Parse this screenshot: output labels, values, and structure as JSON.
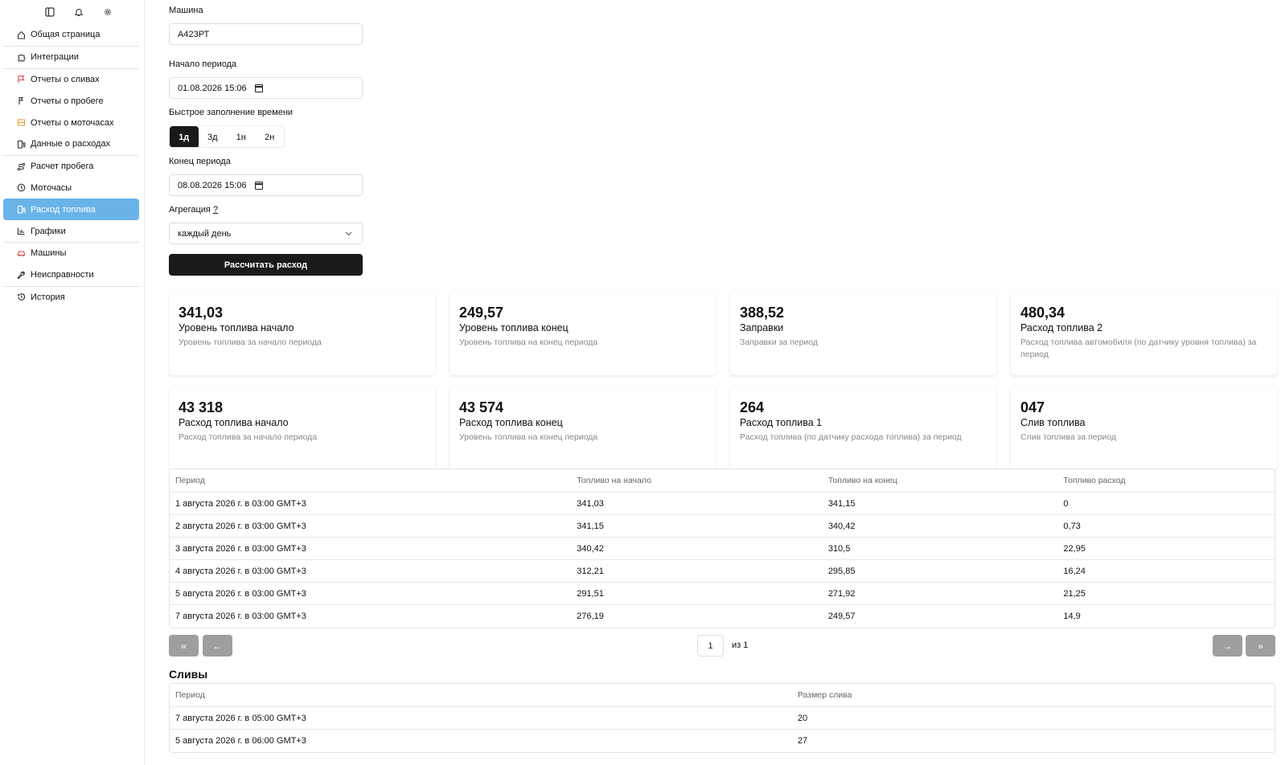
{
  "sidebar": {
    "top_icons": [
      "sidebar-toggle-icon",
      "bell-icon",
      "gear-icon"
    ],
    "items": [
      {
        "label": "Общая страница",
        "icon": "home-icon"
      },
      {
        "label": "Интеграции",
        "icon": "puzzle-icon"
      },
      {
        "label": "Отчеты о сливах",
        "icon": "flag-icon"
      },
      {
        "label": "Отчеты о пробеге",
        "icon": "route-flag-icon"
      },
      {
        "label": "Отчеты о моточасах",
        "icon": "engine-icon"
      },
      {
        "label": "Данные о расходах",
        "icon": "fuel-pump-icon"
      },
      {
        "label": "Расчет пробега",
        "icon": "route-icon"
      },
      {
        "label": "Моточасы",
        "icon": "clock-icon"
      },
      {
        "label": "Расход топлива",
        "icon": "fuel-icon"
      },
      {
        "label": "Графики",
        "icon": "chart-icon"
      },
      {
        "label": "Машины",
        "icon": "car-icon"
      },
      {
        "label": "Неисправности",
        "icon": "wrench-icon"
      },
      {
        "label": "История",
        "icon": "history-icon"
      }
    ],
    "active_index": 8,
    "accent_color": "#6ab3e8"
  },
  "form": {
    "machine_label": "Машина",
    "machine_value": "А423РТ",
    "start_label": "Начало периода",
    "start_value": "01.08.2026 15:06",
    "quick_label": "Быстрое заполнение времени",
    "quick_options": [
      "1д",
      "3д",
      "1н",
      "2н"
    ],
    "quick_selected": "1д",
    "end_label": "Конец периода",
    "end_value": "08.08.2026 15:06",
    "aggregation_label": "Агрегация",
    "aggregation_help": "?",
    "aggregation_value": "каждый день",
    "submit_label": "Рассчитать расход"
  },
  "cards": [
    {
      "value": "341,03",
      "title": "Уровень топлива начало",
      "subtitle": "Уровень топлива за начало периода"
    },
    {
      "value": "249,57",
      "title": "Уровень топлива конец",
      "subtitle": "Уровень топлива на конец периода"
    },
    {
      "value": "388,52",
      "title": "Заправки",
      "subtitle": "Заправки за период"
    },
    {
      "value": "480,34",
      "title": "Расход топлива 2",
      "subtitle": "Расход топлива автомобиля (по датчику уровня топлива) за период"
    },
    {
      "value": "43 318",
      "title": "Расход топлива начало",
      "subtitle": "Расход топлива за начало периода"
    },
    {
      "value": "43 574",
      "title": "Расход топлива конец",
      "subtitle": "Уровень топлива на конец периода"
    },
    {
      "value": "264",
      "title": "Расход топлива 1",
      "subtitle": "Расход топлива (по датчику расхода топлива) за период"
    },
    {
      "value": "047",
      "title": "Слив топлива",
      "subtitle": "Слив топлива за период"
    }
  ],
  "table": {
    "headers": [
      "Период",
      "Топливо на начало",
      "Топливо на конец",
      "Топливо расход"
    ],
    "rows": [
      [
        "1 августа 2026 г. в 03:00 GMT+3",
        "341,03",
        "341,15",
        "0"
      ],
      [
        "2 августа 2026 г. в 03:00 GMT+3",
        "341,15",
        "340,42",
        "0,73"
      ],
      [
        "3 августа 2026 г. в 03:00 GMT+3",
        "340,42",
        "310,5",
        "22,95"
      ],
      [
        "4 августа 2026 г. в 03:00 GMT+3",
        "312,21",
        "295,85",
        "16,24"
      ],
      [
        "5 августа 2026 г. в 03:00 GMT+3",
        "291,51",
        "271,92",
        "21,25"
      ],
      [
        "7 августа 2026 г. в 03:00 GMT+3",
        "276,19",
        "249,57",
        "14,9"
      ]
    ]
  },
  "pagination": {
    "first": "«",
    "prev": "←",
    "next": "→",
    "last": "»",
    "page": "1",
    "of_text": "из 1"
  },
  "drains": {
    "title": "Сливы",
    "headers": [
      "Период",
      "Размер слива"
    ],
    "rows": [
      [
        "7 августа 2026 г. в 05:00 GMT+3",
        "20"
      ],
      [
        "5 августа 2026 г. в 06:00 GMT+3",
        "27"
      ]
    ]
  }
}
